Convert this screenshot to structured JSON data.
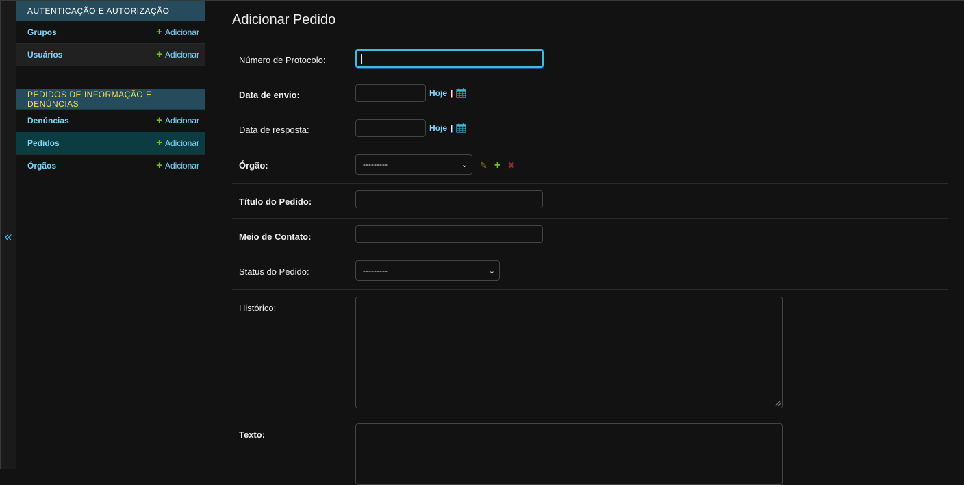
{
  "nav_toggle": {
    "glyph": "«"
  },
  "sidebar": {
    "modules": [
      {
        "caption": "AUTENTICAÇÃO E AUTORIZAÇÃO",
        "models": [
          {
            "name": "Grupos",
            "add": "Adicionar"
          },
          {
            "name": "Usuários",
            "add": "Adicionar"
          }
        ]
      },
      {
        "caption": "PEDIDOS DE INFORMAÇÃO E DENÚNCIAS",
        "models": [
          {
            "name": "Denúncias",
            "add": "Adicionar"
          },
          {
            "name": "Pedidos",
            "add": "Adicionar"
          },
          {
            "name": "Órgãos",
            "add": "Adicionar"
          }
        ]
      }
    ],
    "plus_glyph": "+"
  },
  "content": {
    "title": "Adicionar Pedido",
    "fields": {
      "protocolo": {
        "label": "Número de Protocolo:",
        "value": ""
      },
      "data_envio": {
        "label": "Data de envio:",
        "value": "",
        "today": "Hoje",
        "sep": "|"
      },
      "data_resposta": {
        "label": "Data de resposta:",
        "value": "",
        "today": "Hoje",
        "sep": "|"
      },
      "orgao": {
        "label": "Órgão:",
        "selected": "---------"
      },
      "titulo": {
        "label": "Título do Pedido:",
        "value": ""
      },
      "meio_contato": {
        "label": "Meio de Contato:",
        "value": ""
      },
      "status": {
        "label": "Status do Pedido:",
        "selected": "---------"
      },
      "historico": {
        "label": "Histórico:"
      },
      "texto": {
        "label": "Texto:"
      }
    }
  },
  "colors": {
    "background": "#121212",
    "module_header": "#264b5d",
    "module_caption_text": "#f5dd5d",
    "link": "#81d4fa",
    "add_plus": "#70bf2b",
    "current_row": "#0b3c42",
    "focus_border": "#44b8de"
  }
}
